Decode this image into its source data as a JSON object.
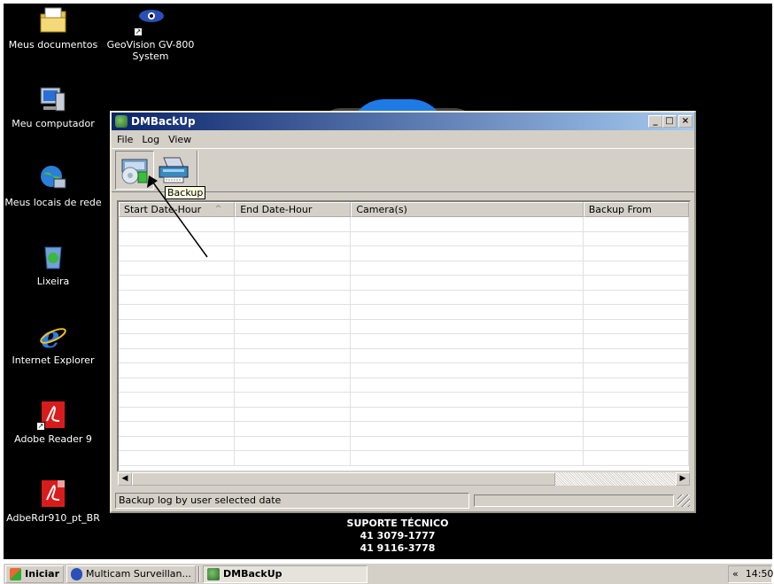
{
  "desktop": {
    "icons": [
      {
        "label": "Meus documentos",
        "icon": "my-documents-icon"
      },
      {
        "label": "GeoVision GV-800\nSystem",
        "icon": "geovision-eye-icon"
      },
      {
        "label": "Meu computador",
        "icon": "my-computer-icon"
      },
      {
        "label": "Meus locais de rede",
        "icon": "network-places-icon"
      },
      {
        "label": "Lixeira",
        "icon": "recycle-bin-icon"
      },
      {
        "label": "Internet Explorer",
        "icon": "internet-explorer-icon"
      },
      {
        "label": "Adobe Reader 9",
        "icon": "adobe-reader-icon"
      },
      {
        "label": "AdbeRdr910_pt_BR",
        "icon": "adobe-installer-icon"
      }
    ],
    "support": {
      "line1": "SUPORTE TÉCNICO",
      "line2": "41 3079-1777",
      "line3": "41 9116-3778"
    }
  },
  "window": {
    "title": "DMBackUp",
    "controls": {
      "minimize": "_",
      "maximize": "□",
      "close": "×"
    },
    "menu": [
      "File",
      "Log",
      "View"
    ],
    "toolbar": {
      "buttons": [
        {
          "name": "backup",
          "icon": "backup-drive-icon"
        },
        {
          "name": "printer",
          "icon": "printer-icon"
        }
      ],
      "tooltip": "Backup"
    },
    "list": {
      "columns": [
        "Start Date-Hour",
        "End Date-Hour",
        "Camera(s)",
        "Backup From"
      ],
      "sort_indicator": "^"
    },
    "status": {
      "text": "Backup log by user selected date"
    }
  },
  "taskbar": {
    "start_label": "Iniciar",
    "items": [
      "Multicam Surveillan...",
      "DMBackUp"
    ],
    "tray_chevron": "«",
    "clock": "14:50"
  }
}
